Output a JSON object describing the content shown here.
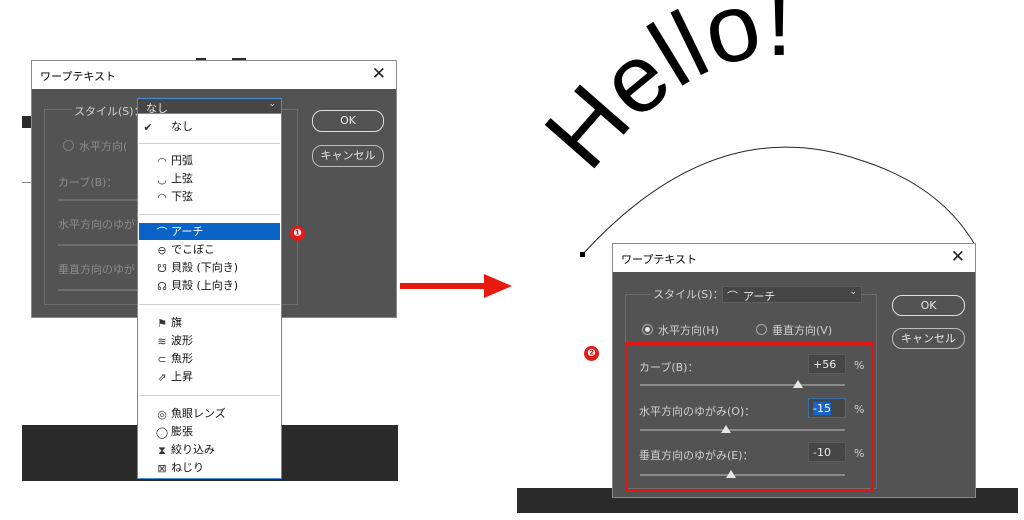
{
  "left_dialog": {
    "title": "ワープテキスト",
    "close": "✕",
    "style_label": "スタイル(S)：",
    "style_value": "なし",
    "horizontal_label": "水平方向(",
    "bend_label": "カーブ(B)：",
    "h_distort_label": "水平方向のゆが",
    "v_distort_label": "垂直方向のゆが",
    "ok": "OK",
    "cancel": "キャンセル",
    "badge": "❶"
  },
  "dropdown": {
    "checked": "✔",
    "items": [
      {
        "label": "なし",
        "icon": ""
      },
      {
        "label": "円弧",
        "icon": "◠"
      },
      {
        "label": "上弦",
        "icon": "◡"
      },
      {
        "label": "下弦",
        "icon": "◠"
      },
      {
        "label": "アーチ",
        "icon": "⌒"
      },
      {
        "label": "でこぼこ",
        "icon": "⊖"
      },
      {
        "label": "貝殻 (下向き)",
        "icon": "☋"
      },
      {
        "label": "貝殻 (上向き)",
        "icon": "☊"
      },
      {
        "label": "旗",
        "icon": "⚑"
      },
      {
        "label": "波形",
        "icon": "≋"
      },
      {
        "label": "魚形",
        "icon": "⊂"
      },
      {
        "label": "上昇",
        "icon": "⇗"
      },
      {
        "label": "魚眼レンズ",
        "icon": "◎"
      },
      {
        "label": "膨張",
        "icon": "◯"
      },
      {
        "label": "絞り込み",
        "icon": "⧗"
      },
      {
        "label": "ねじり",
        "icon": "⊠"
      }
    ]
  },
  "arrow_color": "#e8190f",
  "right_dialog": {
    "title": "ワープテキスト",
    "close": "✕",
    "style_label": "スタイル(S)：",
    "style_value": "アーチ",
    "horizontal": "水平方向(H)",
    "vertical": "垂直方向(V)",
    "bend_label": "カーブ(B)：",
    "bend_value": "+56",
    "bend_level_percent": 56,
    "h_distort_label": "水平方向のゆがみ(O)：",
    "h_distort_value": "-15",
    "h_distort_level_percent": -15,
    "v_distort_label": "垂直方向のゆがみ(E)：",
    "v_distort_value": "-10",
    "v_distort_level_percent": -10,
    "percent": "%",
    "ok": "OK",
    "cancel": "キャンセル",
    "badge": "❷"
  },
  "warped_text": "Hello!"
}
